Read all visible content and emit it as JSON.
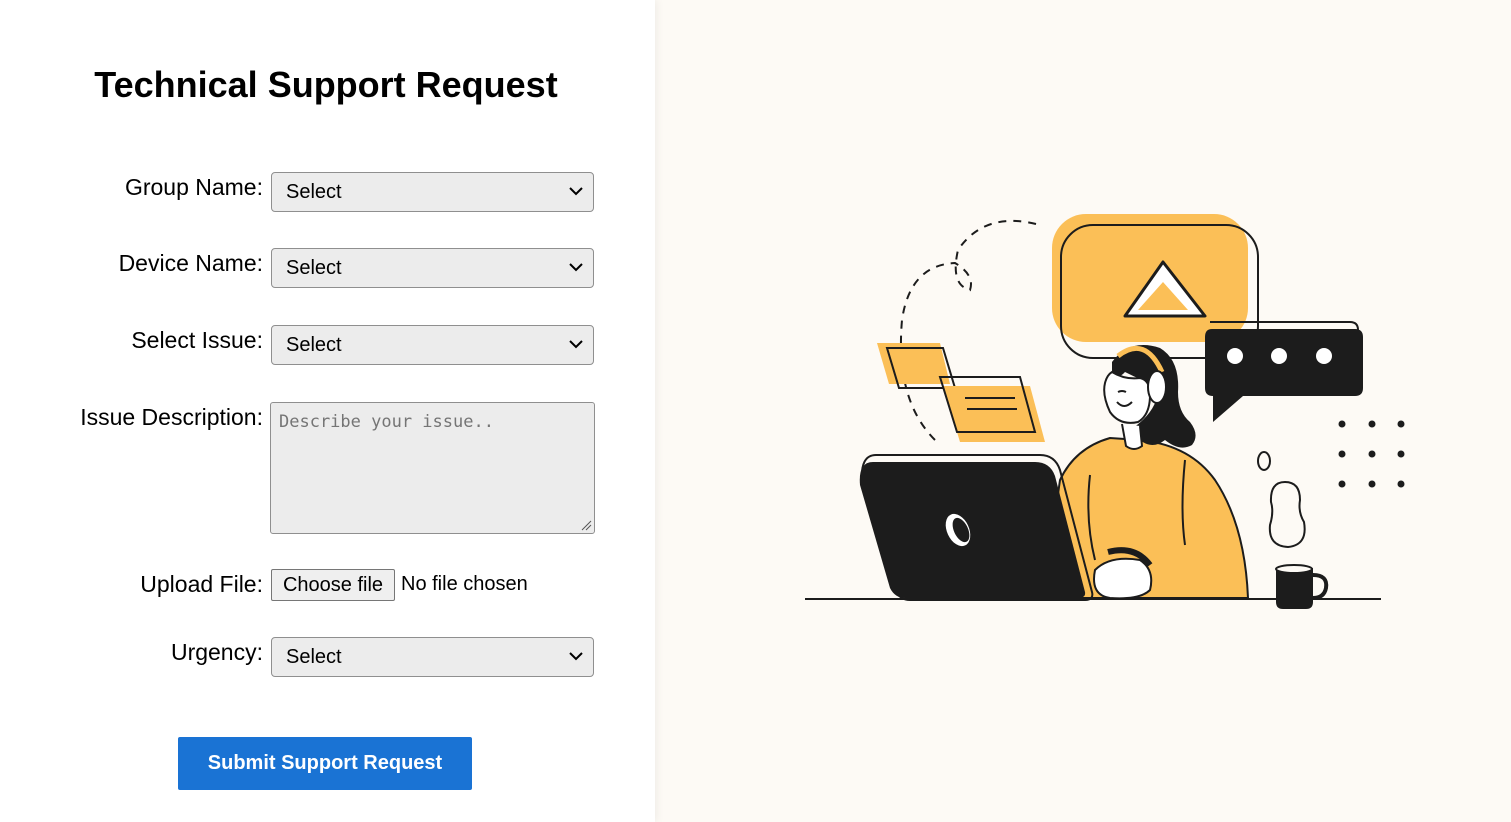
{
  "form": {
    "title": "Technical Support Request",
    "group_name": {
      "label": "Group Name:",
      "value": "Select"
    },
    "device_name": {
      "label": "Device Name:",
      "value": "Select"
    },
    "select_issue": {
      "label": "Select Issue:",
      "value": "Select"
    },
    "issue_description": {
      "label": "Issue Description:",
      "placeholder": "Describe your issue..",
      "value": ""
    },
    "upload_file": {
      "label": "Upload File:",
      "button_label": "Choose file",
      "status": "No file chosen"
    },
    "urgency": {
      "label": "Urgency:",
      "value": "Select"
    },
    "submit_label": "Submit Support Request"
  },
  "colors": {
    "accent": "#1a73d4",
    "illustration_yellow": "#fbbf57",
    "illustration_dark": "#1c1c1c",
    "right_background": "#fdfaf5"
  },
  "illustration": {
    "description_icon": "support-agent-illustration"
  }
}
